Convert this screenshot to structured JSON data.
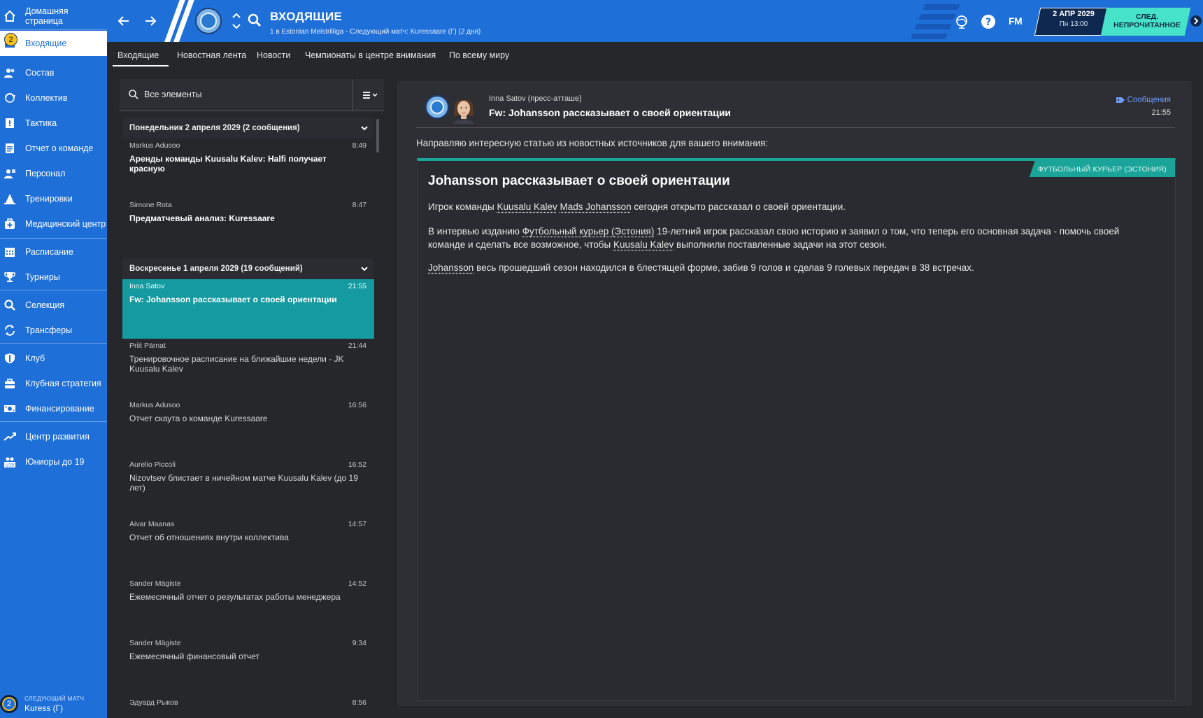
{
  "sidebar": {
    "inbox_badge": "2",
    "items": [
      {
        "label": "Домашняя страница"
      },
      {
        "label": "Входящие"
      },
      {
        "label": "Состав"
      },
      {
        "label": "Коллектив"
      },
      {
        "label": "Тактика"
      },
      {
        "label": "Отчет о команде"
      },
      {
        "label": "Персонал"
      },
      {
        "label": "Тренировки"
      },
      {
        "label": "Медицинский центр"
      },
      {
        "label": "Расписание"
      },
      {
        "label": "Турниры"
      },
      {
        "label": "Селекция"
      },
      {
        "label": "Трансферы"
      },
      {
        "label": "Клуб"
      },
      {
        "label": "Клубная стратегия"
      },
      {
        "label": "Финансирование"
      },
      {
        "label": "Центр развития"
      },
      {
        "label": "Юниоры до 19"
      }
    ],
    "next_match": {
      "label": "СЛЕДУЮЩИЙ МАТЧ",
      "value": "Kuress (Г)",
      "count": "2"
    }
  },
  "header": {
    "title": "ВХОДЯЩИЕ",
    "subtitle": "1 в Estonian Meistriliiga - Следующий матч: Kuressaare (Г) (2 дня)",
    "logo": "FM",
    "date": "2 АПР 2029",
    "time": "Пн 13:00",
    "continue_label": "СЛЕД. НЕПРОЧИТАННОЕ"
  },
  "tabs": [
    {
      "label": "Входящие"
    },
    {
      "label": "Новостная лента"
    },
    {
      "label": "Новости"
    },
    {
      "label": "Чемпионаты в центре внимания"
    },
    {
      "label": "По всему миру"
    }
  ],
  "list": {
    "search_label": "Все элементы",
    "groups": [
      {
        "title": "Понедельник 2 апреля 2029 (2 сообщения)",
        "messages": [
          {
            "sender": "Markus Adusoo",
            "time": "8:49",
            "subject": "Аренды команды Kuusalu Kalev: Halfi получает красную"
          },
          {
            "sender": "Simone Rota",
            "time": "8:47",
            "subject": "Предматчевый анализ: Kuressaare"
          }
        ]
      },
      {
        "title": "Воскресенье 1 апреля 2029 (19 сообщений)",
        "messages": [
          {
            "sender": "Inna Satov",
            "time": "21:55",
            "subject": "Fw: Johansson рассказывает о своей ориентации"
          },
          {
            "sender": "Priit Pärnat",
            "time": "21:44",
            "subject": "Тренировочное расписание на ближайшие недели - JK Kuusalu Kalev"
          },
          {
            "sender": "Markus Adusoo",
            "time": "16:56",
            "subject": "Отчет скаута о команде Kuressaare"
          },
          {
            "sender": "Aurelio Piccoli",
            "time": "16:52",
            "subject": "Nizovtsev блистает в ничейном матче Kuusalu Kalev (до 19 лет)"
          },
          {
            "sender": "Aivar Maanas",
            "time": "14:57",
            "subject": "Отчет об отношениях внутри коллектива"
          },
          {
            "sender": "Sander Mägiste",
            "time": "14:52",
            "subject": "Ежемесячный отчет о результатах работы менеджера"
          },
          {
            "sender": "Sander Mägiste",
            "time": "9:34",
            "subject": "Ежемесячный финансовый отчет"
          },
          {
            "sender": "Эдуард Рыков",
            "time": "8:56",
            "subject": ""
          }
        ]
      }
    ]
  },
  "message": {
    "sender": "Inna Satov",
    "role": "(пресс-атташе)",
    "subject": "Fw: Johansson рассказывает о своей ориентации",
    "category": "Сообщения",
    "time": "21:55",
    "intro": "Направляю интересную статью из новостных источников для вашего внимания:",
    "article": {
      "source": "ФУТБОЛЬНЫЙ КУРЬЕР (ЭСТОНИЯ)",
      "title": "Johansson рассказывает о своей ориентации",
      "p1_a": "Игрок команды ",
      "p1_club": "Kuusalu Kalev",
      "p1_player": "Mads Johansson",
      "p1_b": " сегодня открыто рассказал о своей ориентации.",
      "p2_a": "В интервью изданию ",
      "p2_source": "Футбольный курьер (Эстония)",
      "p2_b": " 19-летний игрок рассказал свою историю и заявил о том, что теперь его основная задача - помочь своей команде и сделать все возможное, чтобы ",
      "p2_club": "Kuusalu Kalev",
      "p2_c": " выполнили поставленные задачи на этот сезон.",
      "p3_player": "Johansson",
      "p3_b": " весь прошедший сезон находился в блестящей форме, забив 9 голов и сделав 9 голевых передач в 38 встречах."
    }
  },
  "colors": {
    "sidebar": "#1f6fd8",
    "accent_teal": "#159aa0",
    "continue": "#46e3c9",
    "background": "#26272b",
    "badge": "#f6c21b"
  }
}
